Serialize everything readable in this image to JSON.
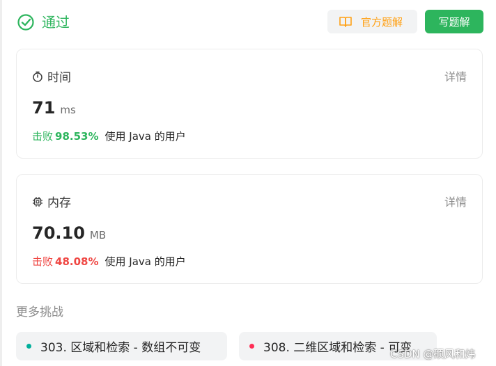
{
  "header": {
    "status_text": "通过",
    "official_solution_label": "官方题解",
    "write_solution_label": "写题解"
  },
  "time_card": {
    "title": "时间",
    "detail_label": "详情",
    "value": "71",
    "unit": "ms",
    "beats_label": "击败",
    "beats_pct": "98.53%",
    "beats_suffix": "使用 Java 的用户"
  },
  "memory_card": {
    "title": "内存",
    "detail_label": "详情",
    "value": "70.10",
    "unit": "MB",
    "beats_label": "击败",
    "beats_pct": "48.08%",
    "beats_suffix": "使用 Java 的用户"
  },
  "more_challenges": {
    "title": "更多挑战",
    "items": [
      {
        "label": "303. 区域和检索 - 数组不可变"
      },
      {
        "label": "308. 二维区域和检索 - 可变"
      }
    ]
  },
  "watermark": "CSDN @硕风和炜",
  "colors": {
    "success": "#2db55d",
    "warning_accent": "#ffa116",
    "danger": "#ef4743",
    "dot_easy": "#00af9b",
    "dot_hard": "#ff2d55"
  },
  "icons": {
    "status": "check-circle-icon",
    "official_solution": "book-icon",
    "time": "stopwatch-icon",
    "memory": "chip-icon"
  }
}
